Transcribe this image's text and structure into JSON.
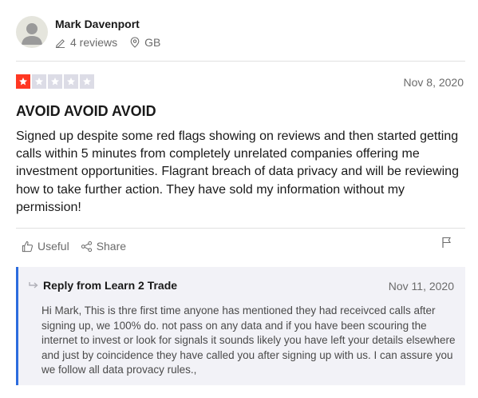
{
  "reviewer": {
    "name": "Mark Davenport",
    "reviews": "4 reviews",
    "country": "GB"
  },
  "review": {
    "rating": 1,
    "max_rating": 5,
    "star_color": "#ff3722",
    "empty_star_color": "#dcdce6",
    "date": "Nov 8, 2020",
    "title": "AVOID AVOID AVOID",
    "text": "Signed up despite some red flags showing on reviews and then started getting calls within 5 minutes from completely unrelated companies offering me investment opportunities. Flagrant breach of data privacy and will be reviewing how to take further action. They have sold my information without my permission!"
  },
  "actions": {
    "useful_label": "Useful",
    "share_label": "Share"
  },
  "reply": {
    "heading": "Reply from Learn 2 Trade",
    "date": "Nov 11, 2020",
    "text": "Hi Mark, This is thre first time anyone has mentioned they had receivced calls after signing up, we 100% do. not pass on any data and if you have been scouring the internet to invest or look for signals it sounds likely you have left your details elsewhere and just by coincidence they have called you after signing up with us. I can assure you we follow all data provacy rules.,",
    "accent_color": "#2c6cde"
  }
}
